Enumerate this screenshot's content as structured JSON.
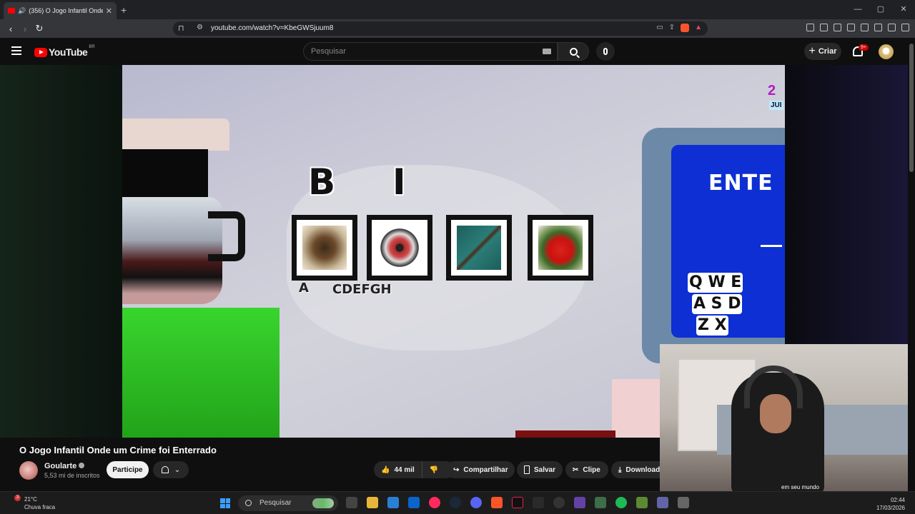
{
  "browser": {
    "tab_title": "(356) O Jogo Infantil Onde um",
    "url": "youtube.com/watch?v=KbeGWSjuum8",
    "new_tab": "+",
    "close_tab": "✕",
    "minimize": "—",
    "maximize": "▢",
    "close_window": "✕"
  },
  "youtube": {
    "logo_text": "YouTube",
    "region": "BR",
    "search_placeholder": "Pesquisar",
    "create_label": "Criar",
    "create_plus": "+",
    "notifications_badge": "9+"
  },
  "video": {
    "overlay_letters": {
      "b": "B",
      "i": "I",
      "a": "A",
      "cdefgh": "CDEFGH"
    },
    "monitor_text": "ENTE",
    "keyboard_rows": [
      "Q W E",
      "A S D",
      "Z X"
    ],
    "corner_number": "2",
    "corner_badge": "JUI",
    "webcam_caption": "em seu mundo",
    "title": "O Jogo Infantil Onde um Crime foi Enterrado"
  },
  "channel": {
    "name": "Goularte",
    "subscribers": "5,53 mi de inscritos",
    "join_label": "Participe"
  },
  "actions": {
    "likes": "44 mil",
    "share": "Compartilhar",
    "save": "Salvar",
    "clip": "Clipe",
    "download": "Download"
  },
  "taskbar": {
    "weather_alerts": "3",
    "temperature": "21°C",
    "weather_desc": "Chuva fraca",
    "search_label": "Pesquisar",
    "time": "02:44",
    "date": "17/03/2026"
  },
  "colors": {
    "youtube_red": "#ff0000",
    "background": "#0f0f0f",
    "monitor_blue": "#0d2fd3",
    "green_block": "#39d52e"
  }
}
